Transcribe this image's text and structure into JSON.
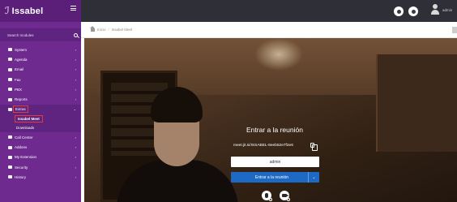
{
  "brand": {
    "name": "Issabel",
    "logo_glyph": "ℐ"
  },
  "sidebar": {
    "search_placeholder": "Search modules",
    "items": [
      {
        "label": "System",
        "icon": "computer-icon"
      },
      {
        "label": "Agenda",
        "icon": "calendar-icon"
      },
      {
        "label": "Email",
        "icon": "envelope-icon"
      },
      {
        "label": "Fax",
        "icon": "printer-icon"
      },
      {
        "label": "PBX",
        "icon": "phone-icon"
      },
      {
        "label": "Reports",
        "icon": "chart-icon"
      },
      {
        "label": "Extras",
        "icon": "plus-circle-icon"
      }
    ],
    "extras_children": [
      {
        "label": "Issabel Meet"
      },
      {
        "label": "Downloads"
      }
    ],
    "items_after": [
      {
        "label": "Call Center",
        "icon": "headset-icon"
      },
      {
        "label": "Addons",
        "icon": "puzzle-icon"
      },
      {
        "label": "My Extension",
        "icon": "extension-icon"
      },
      {
        "label": "Security",
        "icon": "shield-icon"
      },
      {
        "label": "History",
        "icon": "history-icon"
      }
    ]
  },
  "topbar": {
    "user_name": "admin"
  },
  "breadcrumb": {
    "home": "Inicio",
    "separator": "/",
    "current": "Issabel Meet"
  },
  "meet": {
    "title": "Entrar a la reunión",
    "meeting_url": "meet.jit.si/ISSABEL-8eeb52e7f2e6",
    "name_value": "admin",
    "join_label": "Entrar a la reunión",
    "join_caret": "⌄"
  }
}
